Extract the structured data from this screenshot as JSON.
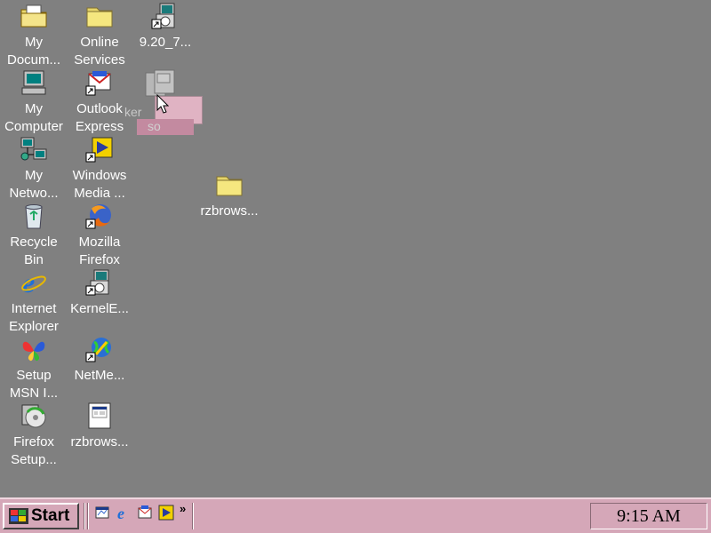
{
  "desktop": {
    "icons": [
      {
        "label": "My\nDocum...",
        "icon": "my-documents-icon"
      },
      {
        "label": "Online\nServices",
        "icon": "folder-icon"
      },
      {
        "label": "9.20_7...",
        "icon": "installer-icon"
      },
      {
        "label": "My\nComputer",
        "icon": "computer-icon"
      },
      {
        "label": "Outlook\nExpress",
        "icon": "outlook-express-icon"
      },
      {
        "label": "My\nNetwo...",
        "icon": "network-icon"
      },
      {
        "label": "Windows\nMedia ...",
        "icon": "media-player-icon"
      },
      {
        "label": "rzbrows...",
        "icon": "folder-icon"
      },
      {
        "label": "Recycle\nBin",
        "icon": "recycle-bin-icon"
      },
      {
        "label": "Mozilla\nFirefox",
        "icon": "firefox-icon"
      },
      {
        "label": "Internet\nExplorer",
        "icon": "internet-explorer-icon"
      },
      {
        "label": "KernelE...",
        "icon": "installer-icon"
      },
      {
        "label": "Setup\nMSN I...",
        "icon": "msn-butterfly-icon"
      },
      {
        "label": "NetMe...",
        "icon": "netmeeting-icon"
      },
      {
        "label": "Firefox\nSetup...",
        "icon": "firefox-setup-icon"
      },
      {
        "label": "rzbrows...",
        "icon": "document-icon"
      }
    ],
    "drag_ghost": {
      "label1": "ker",
      "label2": "so"
    }
  },
  "taskbar": {
    "start_label": "Start",
    "quick_launch": [
      "desktop-icon",
      "internet-explorer-icon",
      "outlook-express-icon",
      "media-player-icon"
    ],
    "overflow": "»",
    "clock": "9:15 AM"
  },
  "colors": {
    "desktop": "#808080",
    "taskbar": "#d5a7b8"
  }
}
